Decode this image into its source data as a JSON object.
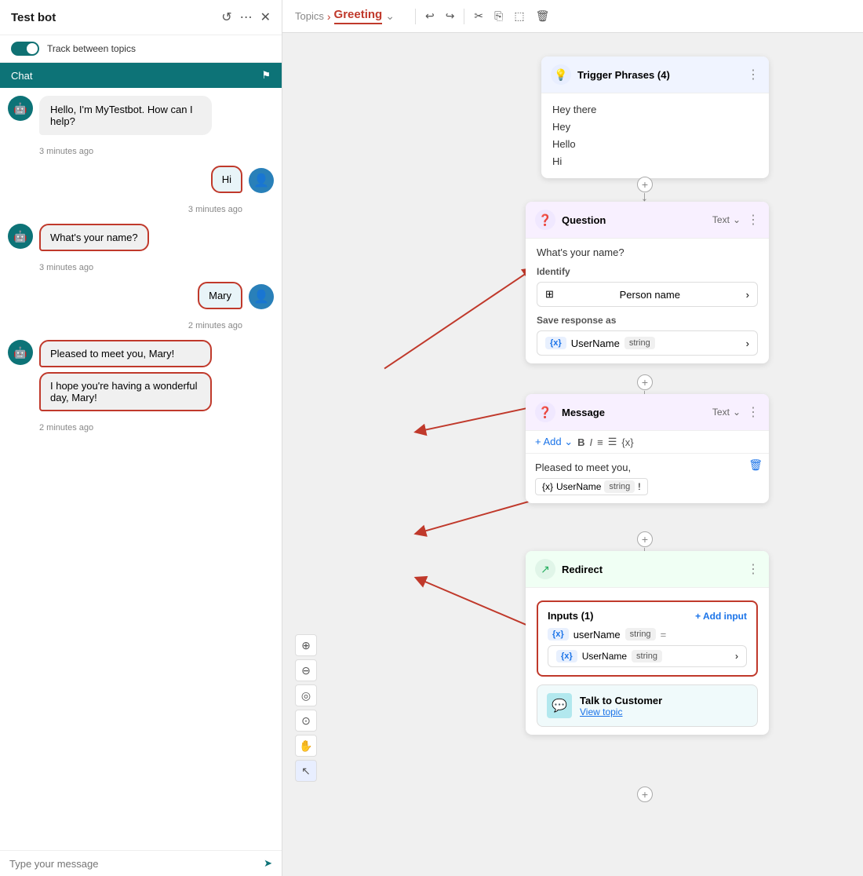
{
  "leftPanel": {
    "title": "Test bot",
    "toggleLabel": "Track between topics",
    "chatTab": "Chat",
    "messages": [
      {
        "type": "bot",
        "text": "Hello, I'm MyTestbot. How can I help?",
        "time": "3 minutes ago"
      },
      {
        "type": "user",
        "text": "Hi",
        "time": "3 minutes ago",
        "highlighted": true
      },
      {
        "type": "bot",
        "text": "What's your name?",
        "time": "3 minutes ago",
        "highlighted": true
      },
      {
        "type": "user",
        "text": "Mary",
        "time": "2 minutes ago",
        "highlighted": false
      },
      {
        "type": "bot",
        "text": "Pleased to meet you, Mary!",
        "time": "2 minutes ago",
        "highlighted": true
      },
      {
        "type": "bot",
        "text": "I hope you're having a wonderful day, Mary!",
        "time": "2 minutes ago",
        "highlighted": true
      }
    ],
    "inputPlaceholder": "Type your message"
  },
  "topbar": {
    "topicsLabel": "Topics",
    "currentLabel": "Greeting",
    "toolbarButtons": [
      "undo",
      "redo",
      "cut",
      "copy",
      "paste",
      "delete"
    ]
  },
  "triggerNode": {
    "title": "Trigger Phrases (4)",
    "phrases": [
      "Hey there",
      "Hey",
      "Hello",
      "Hi"
    ]
  },
  "questionNode": {
    "title": "Question",
    "typeLabel": "Text",
    "questionText": "What's your name?",
    "identifyLabel": "Identify",
    "identifyValue": "Person name",
    "saveLabel": "Save response as",
    "varName": "UserName",
    "varType": "string"
  },
  "messageNode": {
    "title": "Message",
    "typeLabel": "Text",
    "addLabel": "+ Add",
    "text": "Pleased to meet you,",
    "varName": "UserName",
    "varType": "string"
  },
  "redirectNode": {
    "title": "Redirect",
    "inputsLabel": "Inputs (1)",
    "addInputLabel": "+ Add input",
    "inputVar": "userName",
    "inputType": "string",
    "inputValue": "UserName",
    "inputValueType": "string",
    "talkLabel": "Talk to Customer",
    "viewTopicLabel": "View topic"
  },
  "zoomTools": [
    "zoom-in",
    "zoom-out",
    "fit",
    "center",
    "hand",
    "select"
  ],
  "icons": {
    "close": "✕",
    "reload": "↺",
    "menu": "⋯",
    "flag": "⚑",
    "send": "➤",
    "undo": "↩",
    "redo": "↪",
    "cut": "✂",
    "copy": "⎘",
    "paste": "📋",
    "delete": "🗑",
    "down": "⌄",
    "more": "⋮",
    "chevron": "›",
    "plus": "+",
    "zoomIn": "⊕",
    "zoomOut": "⊖",
    "fit": "◎",
    "crosshair": "⊙",
    "hand": "✋",
    "select": "↖",
    "bold": "B",
    "italic": "I",
    "orderedList": "≡",
    "unorderedList": "☰",
    "variable": "{x}",
    "trashBlue": "🗑",
    "personName": "⊞",
    "varX": "{x}"
  }
}
